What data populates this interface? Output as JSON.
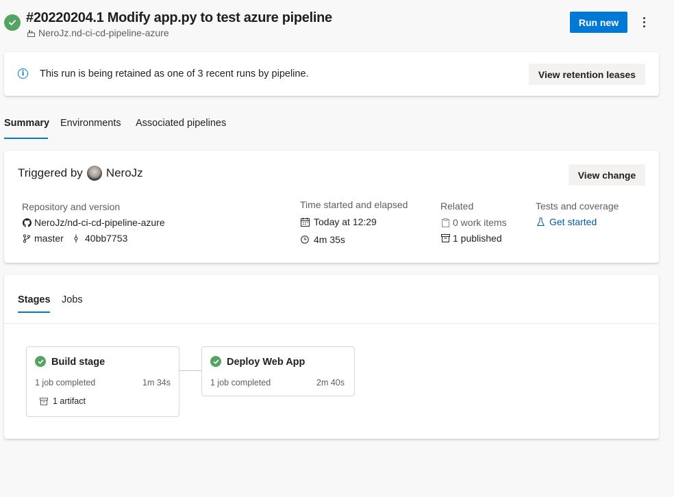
{
  "header": {
    "title": "#20220204.1 Modify app.py to test azure pipeline",
    "repo": "NeroJz.nd-ci-cd-pipeline-azure",
    "run_new_label": "Run new"
  },
  "retention": {
    "message": "This run is being retained as one of 3 recent runs by pipeline.",
    "button_label": "View retention leases"
  },
  "tabs": [
    {
      "label": "Summary",
      "active": true
    },
    {
      "label": "Environments",
      "active": false
    },
    {
      "label": "Associated pipelines",
      "active": false
    }
  ],
  "summary": {
    "triggered_prefix": "Triggered by",
    "triggered_user": "NeroJz",
    "view_change_label": "View change",
    "repo_section": {
      "label": "Repository and version",
      "repo": "NeroJz/nd-ci-cd-pipeline-azure",
      "branch": "master",
      "commit": "40bb7753"
    },
    "time_section": {
      "label": "Time started and elapsed",
      "started": "Today at 12:29",
      "elapsed": "4m 35s"
    },
    "related_section": {
      "label": "Related",
      "work_items": "0 work items",
      "published": "1 published"
    },
    "tests_section": {
      "label": "Tests and coverage",
      "link": "Get started"
    }
  },
  "stages_panel": {
    "tabs": [
      {
        "label": "Stages",
        "active": true
      },
      {
        "label": "Jobs",
        "active": false
      }
    ],
    "stages": [
      {
        "name": "Build stage",
        "status": "1 job completed",
        "duration": "1m 34s",
        "artifact": "1 artifact"
      },
      {
        "name": "Deploy Web App",
        "status": "1 job completed",
        "duration": "2m 40s"
      }
    ]
  },
  "colors": {
    "accent": "#0078d4",
    "success": "#55a362",
    "link": "#005a9e"
  }
}
